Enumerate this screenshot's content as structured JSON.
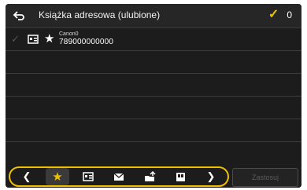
{
  "header": {
    "title": "Książka adresowa (ulubione)",
    "selected_count": "0"
  },
  "entries": [
    {
      "name": "Canon0",
      "number": "789000000000"
    }
  ],
  "toolbar": {
    "items": [
      "prev-chevron",
      "star-icon",
      "address-book-icon",
      "envelope-icon",
      "folder-share-icon",
      "memory-icon",
      "next-chevron"
    ],
    "active_item": "star-icon"
  },
  "apply_button": {
    "label": "Zastosuj",
    "enabled": false
  },
  "colors": {
    "accent": "#f0c000",
    "background": "#1c1c1c"
  }
}
